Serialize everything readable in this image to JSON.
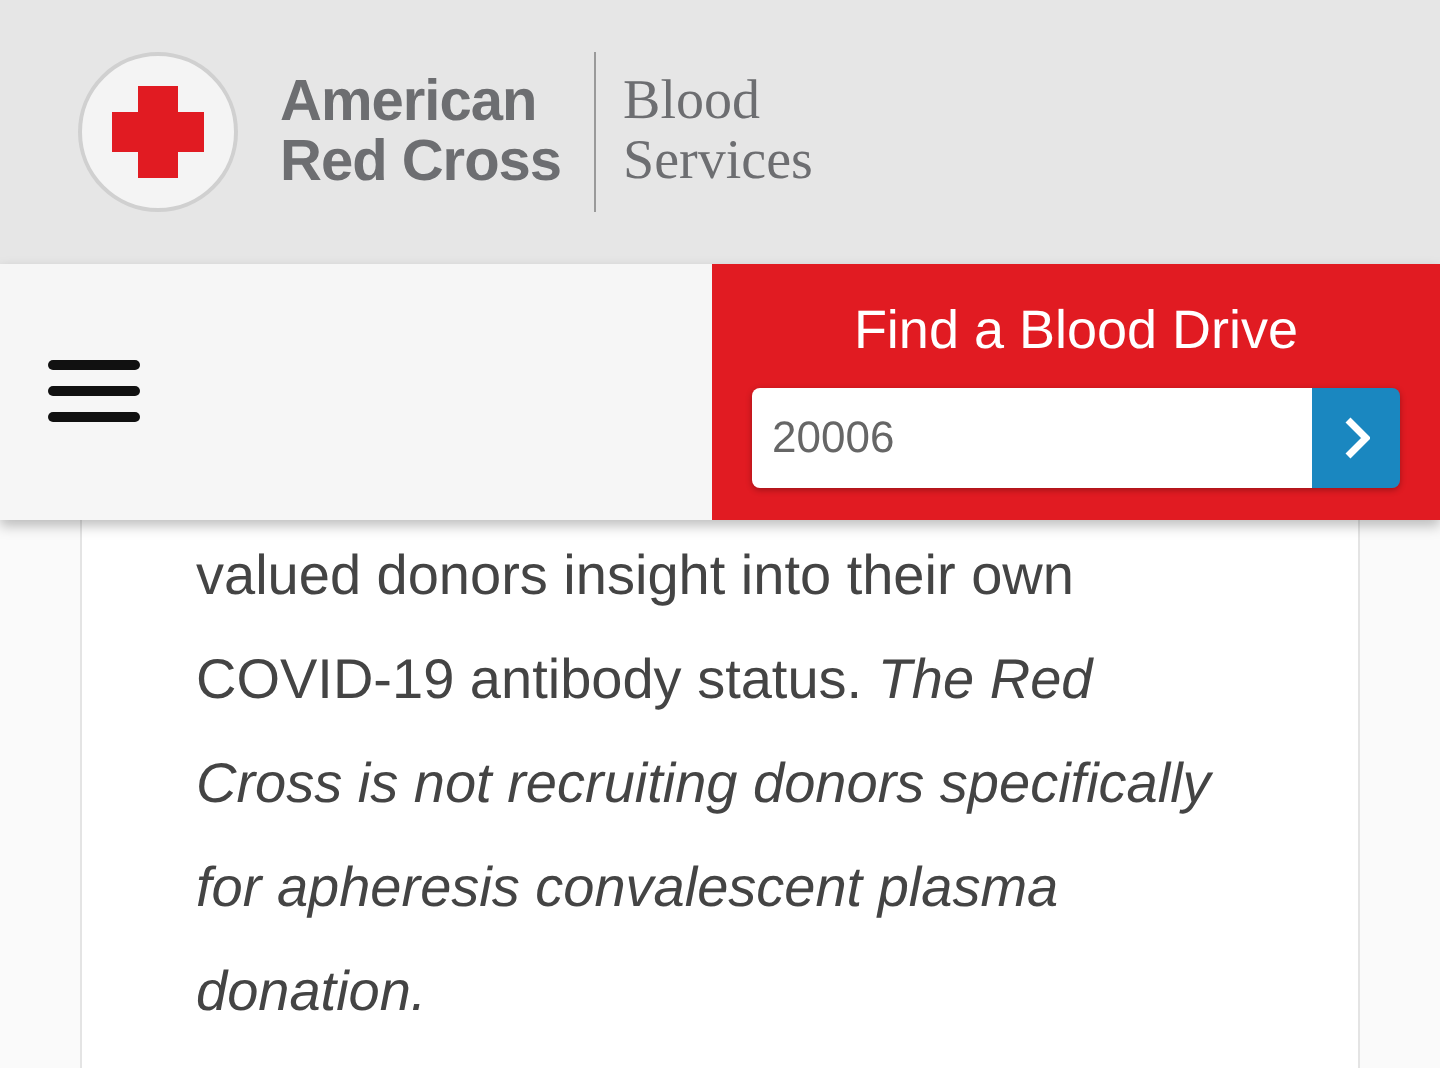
{
  "logo": {
    "name_lines": [
      "American",
      "Red Cross"
    ],
    "division_lines": [
      "Blood",
      "Services"
    ]
  },
  "blood_drive": {
    "title": "Find a Blood Drive",
    "zip_field": {
      "value": "20006"
    }
  },
  "article": {
    "text": "valued donors insight into their own COVID-19 antibody status. *The Red Cross is not recruiting donors specifically for apheresis convalescent plasma donation.*"
  }
}
